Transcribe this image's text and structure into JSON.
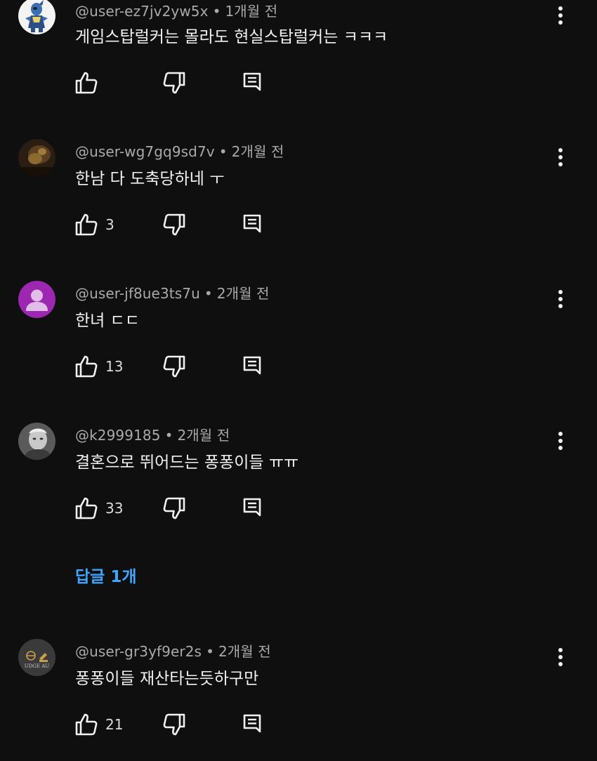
{
  "comments": [
    {
      "handle": "@user-ez7jv2yw5x",
      "time": "1개월 전",
      "text": "게임스탑럴커는 몰라도 현실스탑럴커는 ㅋㅋㅋ",
      "likes": "",
      "avatar": "pokemon-figure"
    },
    {
      "handle": "@user-wg7gq9sd7v",
      "time": "2개월 전",
      "text": "한남 다 도축당하네 ㅜ",
      "likes": "3",
      "avatar": "dark-photo"
    },
    {
      "handle": "@user-jf8ue3ts7u",
      "time": "2개월 전",
      "text": "한녀 ㄷㄷ",
      "likes": "13",
      "avatar": "default-purple-person"
    },
    {
      "handle": "@k2999185",
      "time": "2개월 전",
      "text": "결혼으로 뛰어드는 퐁퐁이들  ㅠㅠ",
      "likes": "33",
      "avatar": "grayscale-portrait",
      "replies": "답글 1개"
    },
    {
      "handle": "@user-gr3yf9er2s",
      "time": "2개월 전",
      "text": "퐁퐁이들 재산타는듯하구만",
      "likes": "21",
      "avatar": "judge-logo",
      "avatar_text": "UDGE AU"
    }
  ],
  "colors": {
    "background": "#0f0f0f",
    "text": "#f1f1f1",
    "meta": "#aaaaaa",
    "link": "#3ea6ff"
  },
  "separator": "•"
}
